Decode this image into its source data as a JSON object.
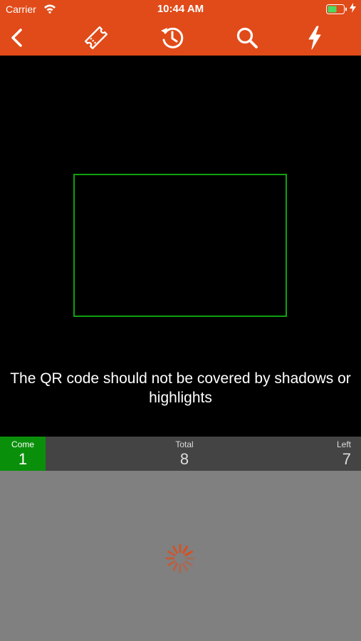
{
  "status_bar": {
    "carrier": "Carrier",
    "time": "10:44 AM"
  },
  "toolbar": {
    "icons": [
      "back-chevron-icon",
      "ticket-icon",
      "history-icon",
      "search-icon",
      "flash-icon"
    ]
  },
  "scanner": {
    "hint": "The QR code should not be covered by shadows or highlights"
  },
  "stats": {
    "come_label": "Come",
    "come_value": "1",
    "total_label": "Total",
    "total_value": "8",
    "left_label": "Left",
    "left_value": "7"
  },
  "colors": {
    "brand": "#E04B19",
    "scan_frame": "#0FA10F",
    "come_bg": "#0A8F0A",
    "stats_bg": "#444444",
    "panel_bg": "#808080"
  }
}
